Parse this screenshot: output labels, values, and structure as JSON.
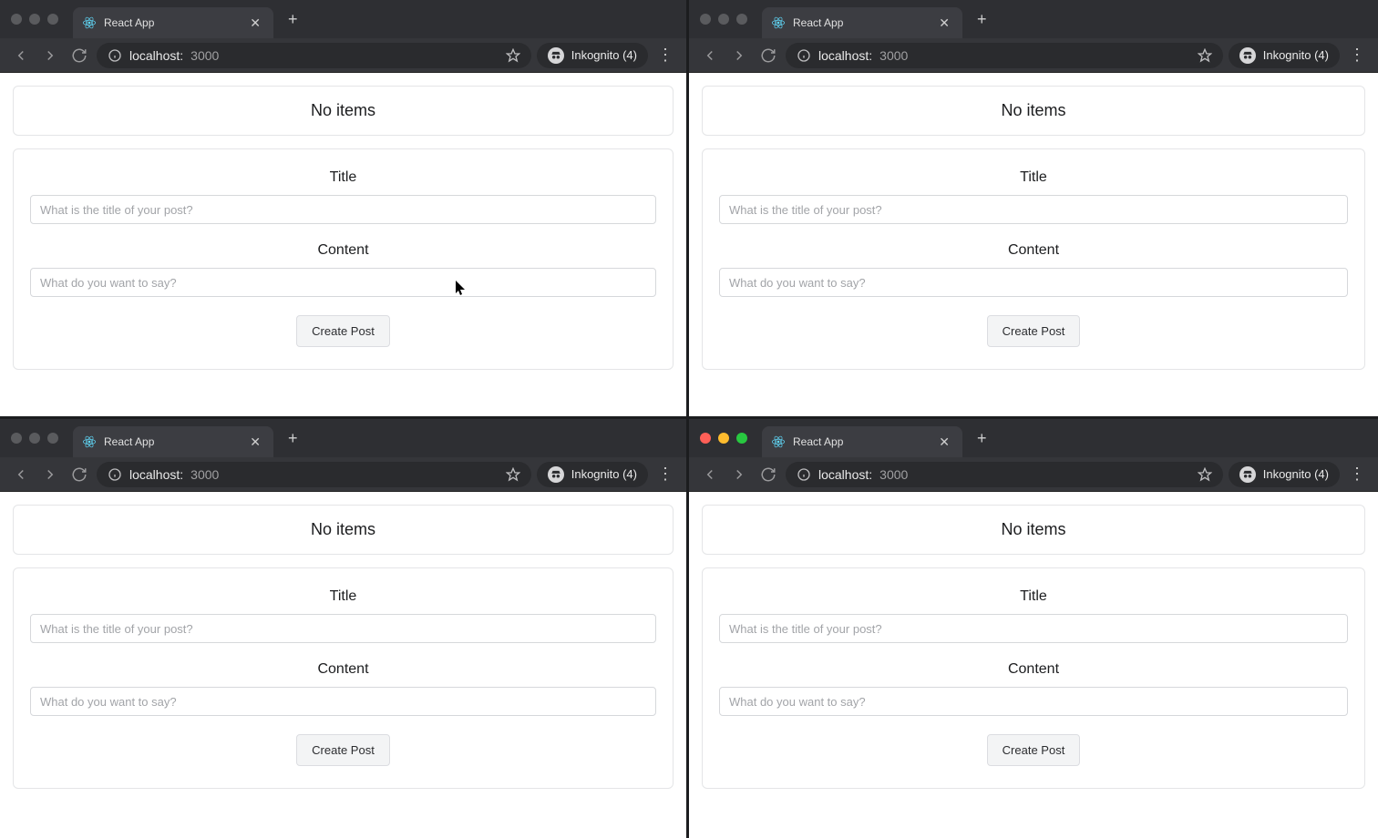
{
  "windows": {
    "w1": {
      "tab_title": "React App",
      "url_host": "localhost:",
      "url_port": "3000",
      "incognito_label": "Inkognito (4)",
      "no_items": "No items",
      "title_label": "Title",
      "title_placeholder": "What is the title of your post?",
      "content_label": "Content",
      "content_placeholder": "What do you want to say?",
      "create_button": "Create Post",
      "traffic_style": "inactive"
    },
    "w2": {
      "tab_title": "React App",
      "url_host": "localhost:",
      "url_port": "3000",
      "incognito_label": "Inkognito (4)",
      "no_items": "No items",
      "title_label": "Title",
      "title_placeholder": "What is the title of your post?",
      "content_label": "Content",
      "content_placeholder": "What do you want to say?",
      "create_button": "Create Post",
      "traffic_style": "inactive"
    },
    "w3": {
      "tab_title": "React App",
      "url_host": "localhost:",
      "url_port": "3000",
      "incognito_label": "Inkognito (4)",
      "no_items": "No items",
      "title_label": "Title",
      "title_placeholder": "What is the title of your post?",
      "content_label": "Content",
      "content_placeholder": "What do you want to say?",
      "create_button": "Create Post",
      "traffic_style": "inactive"
    },
    "w4": {
      "tab_title": "React App",
      "url_host": "localhost:",
      "url_port": "3000",
      "incognito_label": "Inkognito (4)",
      "no_items": "No items",
      "title_label": "Title",
      "title_placeholder": "What is the title of your post?",
      "content_label": "Content",
      "content_placeholder": "What do you want to say?",
      "create_button": "Create Post",
      "traffic_style": "active"
    }
  }
}
